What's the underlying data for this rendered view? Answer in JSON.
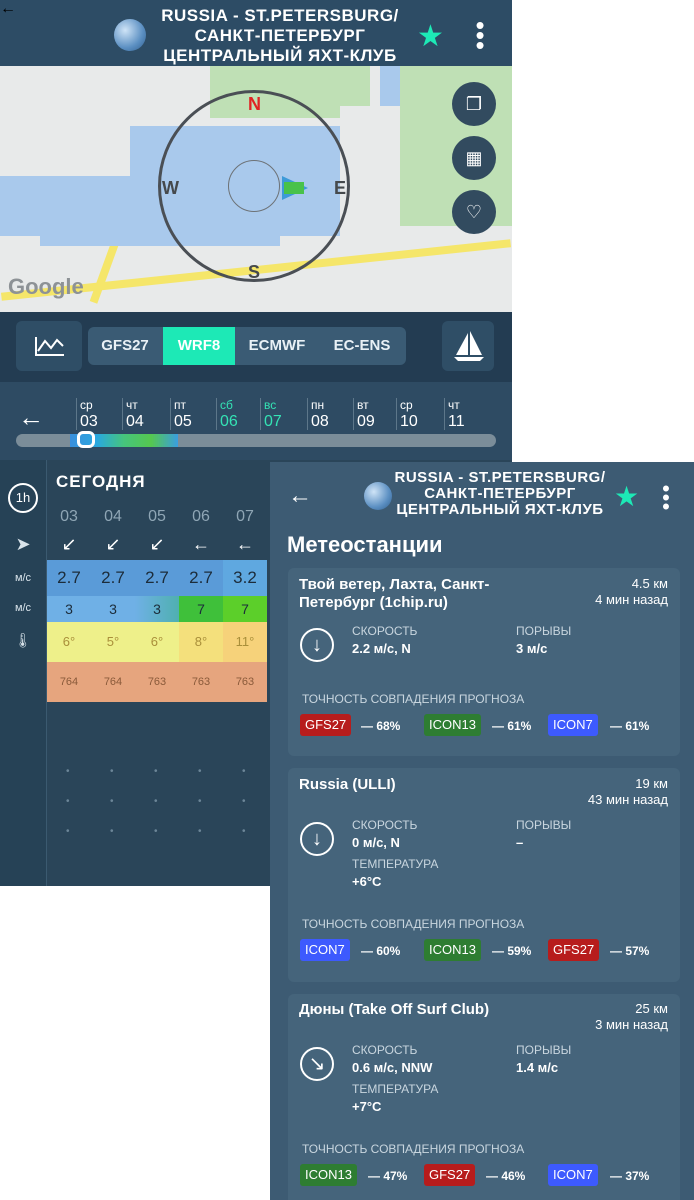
{
  "colors": {
    "accent": "#1de9b6",
    "badge_gfs27": "#b71c1c",
    "badge_icon13": "#2e7d32",
    "badge_icon7": "#3d5afe"
  },
  "back_screen": {
    "header": {
      "title_line1": "RUSSIA - ST.PETERSBURG/",
      "title_line2": "САНКТ-ПЕТЕРБУРГ",
      "title_line3": "ЦЕНТРАЛЬНЫЙ ЯХТ-КЛУБ",
      "back_icon": "arrow-left-icon",
      "favorite_icon": "star-icon",
      "menu_icon": "more-vertical-icon"
    },
    "map": {
      "compass": {
        "n": "N",
        "e": "E",
        "s": "S",
        "w": "W"
      },
      "google_label": "Google"
    },
    "models": [
      "GFS27",
      "WRF8",
      "ECMWF",
      "EC-ENS"
    ],
    "active_model": "WRF8",
    "days": [
      {
        "name": "ср",
        "date": "03"
      },
      {
        "name": "чт",
        "date": "04"
      },
      {
        "name": "пт",
        "date": "05"
      },
      {
        "name": "сб",
        "date": "06"
      },
      {
        "name": "вс",
        "date": "07"
      },
      {
        "name": "пн",
        "date": "08"
      },
      {
        "name": "вт",
        "date": "09"
      },
      {
        "name": "ср",
        "date": "10"
      },
      {
        "name": "чт",
        "date": "11"
      }
    ],
    "table": {
      "tab_label": "1h",
      "today_label": "СЕГОДНЯ",
      "hours": [
        "03",
        "04",
        "05",
        "06",
        "07"
      ],
      "unit_speed": "м/с",
      "unit_gust": "м/с",
      "wind_speed": [
        "2.7",
        "2.7",
        "2.7",
        "2.7",
        "3.2"
      ],
      "wind_gust": [
        "3",
        "3",
        "3",
        "7",
        "7"
      ],
      "temperature": [
        "6°",
        "5°",
        "6°",
        "8°",
        "11°"
      ],
      "pressure": [
        "764",
        "764",
        "763",
        "763",
        "763"
      ]
    }
  },
  "front_card": {
    "header": {
      "title_line1": "RUSSIA - ST.PETERSBURG/",
      "title_line2": "САНКТ-ПЕТЕРБУРГ",
      "title_line3": "ЦЕНТРАЛЬНЫЙ ЯХТ-КЛУБ"
    },
    "section_title": "Метеостанции",
    "stations": [
      {
        "name_line1": "Твой ветер, Лахта, Санкт-",
        "name_line2": "Петербург (1chip.ru)",
        "distance": "4.5 км",
        "ago": "4 мин назад",
        "speed_label": "СКОРОСТЬ",
        "speed_value": "2.2 м/с, N",
        "gust_label": "ПОРЫВЫ",
        "gust_value": "3 м/с",
        "accuracy_label": "ТОЧНОСТЬ СОВПАДЕНИЯ ПРОГНОЗА",
        "accuracy": [
          {
            "model": "GFS27",
            "pct": "— 68%"
          },
          {
            "model": "ICON13",
            "pct": "— 61%"
          },
          {
            "model": "ICON7",
            "pct": "— 61%"
          }
        ]
      },
      {
        "name_line1": "Russia (ULLI)",
        "distance": "19 км",
        "ago": "43 мин назад",
        "speed_label": "СКОРОСТЬ",
        "speed_value": "0 м/с, N",
        "gust_label": "ПОРЫВЫ",
        "gust_value": "–",
        "temp_label": "ТЕМПЕРАТУРА",
        "temp_value": "+6°C",
        "accuracy_label": "ТОЧНОСТЬ СОВПАДЕНИЯ ПРОГНОЗА",
        "accuracy": [
          {
            "model": "ICON7",
            "pct": "— 60%"
          },
          {
            "model": "ICON13",
            "pct": "— 59%"
          },
          {
            "model": "GFS27",
            "pct": "— 57%"
          }
        ]
      },
      {
        "name_line1": "Дюны (Take Off Surf Club)",
        "distance": "25 км",
        "ago": "3 мин назад",
        "speed_label": "СКОРОСТЬ",
        "speed_value": "0.6 м/с, NNW",
        "gust_label": "ПОРЫВЫ",
        "gust_value": "1.4 м/с",
        "temp_label": "ТЕМПЕРАТУРА",
        "temp_value": "+7°C",
        "accuracy_label": "ТОЧНОСТЬ СОВПАДЕНИЯ ПРОГНОЗА",
        "accuracy": [
          {
            "model": "ICON13",
            "pct": "— 47%"
          },
          {
            "model": "GFS27",
            "pct": "— 46%"
          },
          {
            "model": "ICON7",
            "pct": "— 37%"
          }
        ]
      }
    ]
  }
}
